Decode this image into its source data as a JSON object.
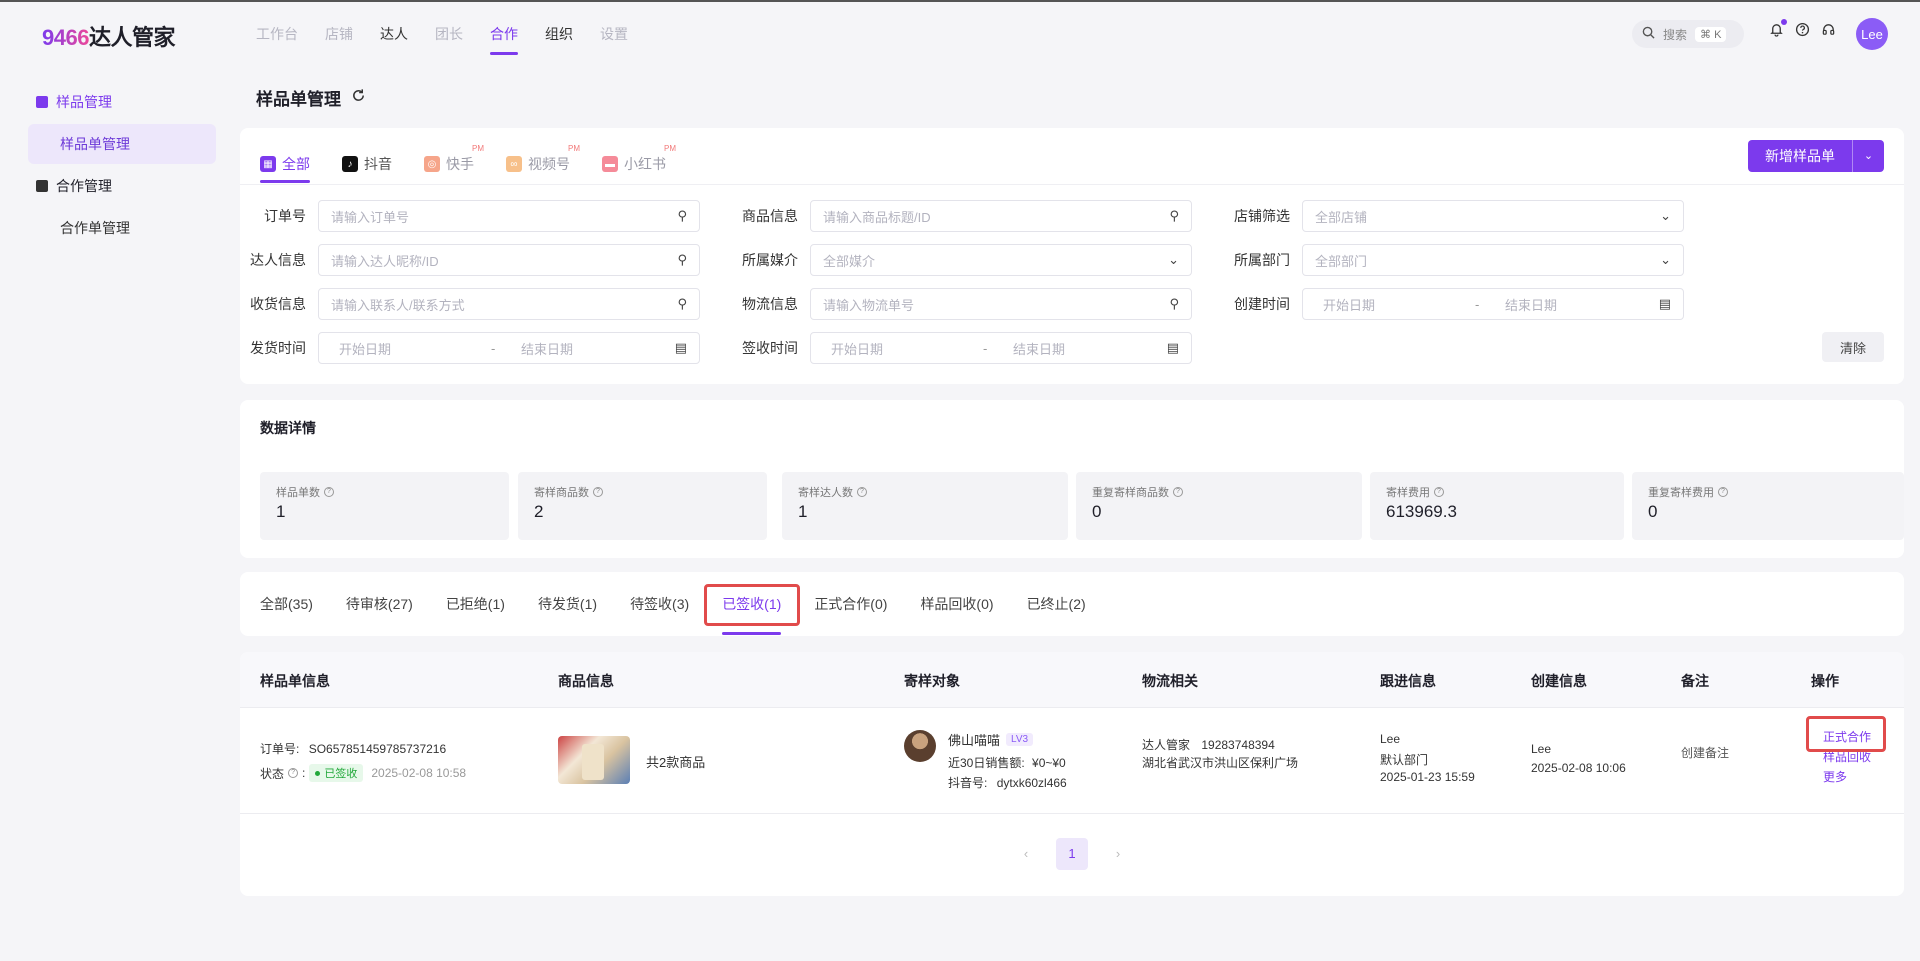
{
  "logo": {
    "num": "9466",
    "text": "达人管家"
  },
  "topnav": [
    {
      "label": "工作台",
      "state": "dim"
    },
    {
      "label": "店铺",
      "state": "dim"
    },
    {
      "label": "达人",
      "state": "dark"
    },
    {
      "label": "团长",
      "state": "dim"
    },
    {
      "label": "合作",
      "state": "active"
    },
    {
      "label": "组织",
      "state": "dark"
    },
    {
      "label": "设置",
      "state": "dim"
    }
  ],
  "search": {
    "label": "搜索",
    "shortcut": "⌘ K"
  },
  "user": {
    "avatar": "Lee"
  },
  "sidebar": {
    "group1": "样品管理",
    "item1": "样品单管理",
    "group2": "合作管理",
    "item2": "合作单管理"
  },
  "page": {
    "title": "样品单管理"
  },
  "platform_tabs": [
    {
      "label": "全部",
      "icon": "grid-icon",
      "color": "#7c3aed"
    },
    {
      "label": "抖音",
      "icon": "douyin-icon",
      "color": "#111111"
    },
    {
      "label": "快手",
      "icon": "kuaishou-icon",
      "color": "#f6a58a",
      "badge": "PM"
    },
    {
      "label": "视频号",
      "icon": "channels-icon",
      "color": "#f7c08a",
      "badge": "PM"
    },
    {
      "label": "小红书",
      "icon": "xiaohongshu-icon",
      "color": "#f58b99",
      "badge": "PM"
    }
  ],
  "add_button": "新增样品单",
  "filters": {
    "order_no": {
      "label": "订单号",
      "placeholder": "请输入订单号"
    },
    "product": {
      "label": "商品信息",
      "placeholder": "请输入商品标题/ID"
    },
    "shop": {
      "label": "店铺筛选",
      "placeholder": "全部店铺"
    },
    "talent": {
      "label": "达人信息",
      "placeholder": "请输入达人昵称/ID"
    },
    "media": {
      "label": "所属媒介",
      "placeholder": "全部媒介"
    },
    "dept": {
      "label": "所属部门",
      "placeholder": "全部部门"
    },
    "receiver": {
      "label": "收货信息",
      "placeholder": "请输入联系人/联系方式"
    },
    "logistics": {
      "label": "物流信息",
      "placeholder": "请输入物流单号"
    },
    "created": {
      "label": "创建时间",
      "start": "开始日期",
      "end": "结束日期"
    },
    "shipped": {
      "label": "发货时间",
      "start": "开始日期",
      "end": "结束日期"
    },
    "signed": {
      "label": "签收时间",
      "start": "开始日期",
      "end": "结束日期"
    },
    "clear": "清除"
  },
  "stats": {
    "title": "数据详情",
    "items": [
      {
        "label": "样品单数",
        "value": "1"
      },
      {
        "label": "寄样商品数",
        "value": "2"
      },
      {
        "label": "寄样达人数",
        "value": "1"
      },
      {
        "label": "重复寄样商品数",
        "value": "0"
      },
      {
        "label": "寄样费用",
        "value": "613969.3"
      },
      {
        "label": "重复寄样费用",
        "value": "0"
      }
    ]
  },
  "status_tabs": [
    "全部(35)",
    "待审核(27)",
    "已拒绝(1)",
    "待发货(1)",
    "待签收(3)",
    "已签收(1)",
    "正式合作(0)",
    "样品回收(0)",
    "已终止(2)"
  ],
  "table": {
    "headers": [
      "样品单信息",
      "商品信息",
      "寄样对象",
      "物流相关",
      "跟进信息",
      "创建信息",
      "备注",
      "操作"
    ],
    "row": {
      "order_label": "订单号:",
      "order_no": "SO657851459785737216",
      "status_label": "状态",
      "status": "已签收",
      "status_time": "2025-02-08 10:58",
      "product_count": "共2款商品",
      "talent_name": "佛山喵喵",
      "talent_level": "LV3",
      "sales_label": "近30日销售额:",
      "sales_value": "¥0~¥0",
      "douyin_label": "抖音号:",
      "douyin_id": "dytxk60zl466",
      "logistics_name": "达人管家",
      "logistics_phone": "19283748394",
      "logistics_addr": "湖北省武汉市洪山区保利广场",
      "follow_user": "Lee",
      "follow_dept": "默认部门",
      "follow_time": "2025-01-23 15:59",
      "create_user": "Lee",
      "create_time": "2025-02-08 10:06",
      "remark": "创建备注",
      "ops": [
        "正式合作",
        "样品回收",
        "更多"
      ]
    }
  },
  "pager": {
    "current": "1"
  }
}
